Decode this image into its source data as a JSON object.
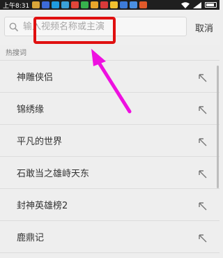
{
  "status_bar": {
    "time": "上午8:31",
    "notification_icons": [
      {
        "name": "app-icon-1",
        "color": "#d9a63a"
      },
      {
        "name": "app-icon-2",
        "color": "#3d6bd8"
      },
      {
        "name": "app-icon-3",
        "color": "#1f9be0"
      },
      {
        "name": "app-icon-4",
        "color": "#3aa0d8"
      },
      {
        "name": "app-icon-5",
        "color": "#e0463a"
      },
      {
        "name": "app-icon-6",
        "color": "#37b24d"
      },
      {
        "name": "app-icon-7",
        "color": "#e9a72b"
      },
      {
        "name": "app-icon-8",
        "color": "#d93a3a"
      },
      {
        "name": "app-icon-9",
        "color": "#f2c230"
      },
      {
        "name": "app-icon-10",
        "color": "#3d7bd8"
      },
      {
        "name": "app-icon-11",
        "color": "#4a90e2"
      },
      {
        "name": "app-icon-12",
        "color": "#e05a2a"
      }
    ]
  },
  "search": {
    "placeholder": "输入视频名称或主演",
    "cancel_label": "取消"
  },
  "hot_search": {
    "label": "热搜词",
    "items": [
      {
        "label": "神雕侠侣"
      },
      {
        "label": "锦绣缘"
      },
      {
        "label": "平凡的世界"
      },
      {
        "label": "石敢当之雄峙天东"
      },
      {
        "label": "封神英雄榜2"
      },
      {
        "label": "鹿鼎记"
      }
    ]
  },
  "colors": {
    "highlight": "#e01010",
    "arrow": "#ee10e0"
  }
}
